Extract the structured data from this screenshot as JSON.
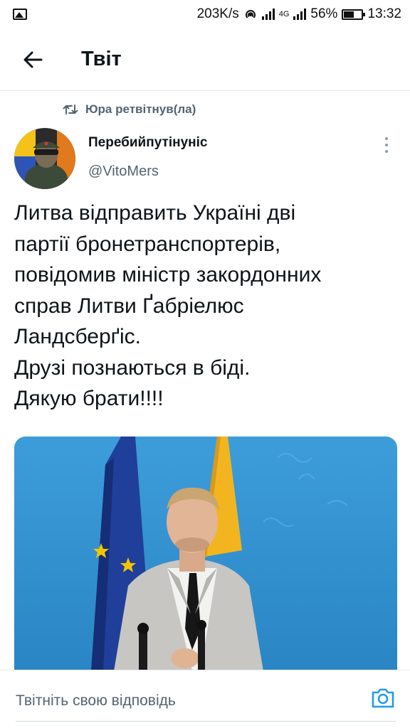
{
  "status_bar": {
    "speed": "203K/s",
    "network": "4G",
    "battery": "56%",
    "time": "13:32",
    "icons": [
      "gallery-icon",
      "hotspot-icon",
      "signal-icon",
      "battery-icon"
    ]
  },
  "header": {
    "title": "Твіт",
    "back_icon": "arrow-left-icon"
  },
  "tweet": {
    "retweeted_by": "Юра ретвітнув(ла)",
    "display_name": "Перебийпутінуніс",
    "handle": "@VitoMers",
    "text_lines": [
      "Литва відправить Україні дві",
      "партії бронетранспортерів,",
      "повідомив міністр закордонних",
      "справ Литви Ґабріелюс",
      "Ландсберґіс.",
      "Друзі познаються в біді.",
      "Дякую брати!!!!"
    ],
    "more_icon": "more-vertical-icon"
  },
  "reply": {
    "placeholder": "Твітніть свою відповідь",
    "camera_icon": "camera-icon"
  },
  "colors": {
    "accent": "#1d9bf0",
    "secondary_text": "#536471",
    "divider": "#e6ecf0",
    "media_sky": "#2e8fd0",
    "eu_flag": "#1f3f9a",
    "lt_yellow": "#f2b51f"
  }
}
